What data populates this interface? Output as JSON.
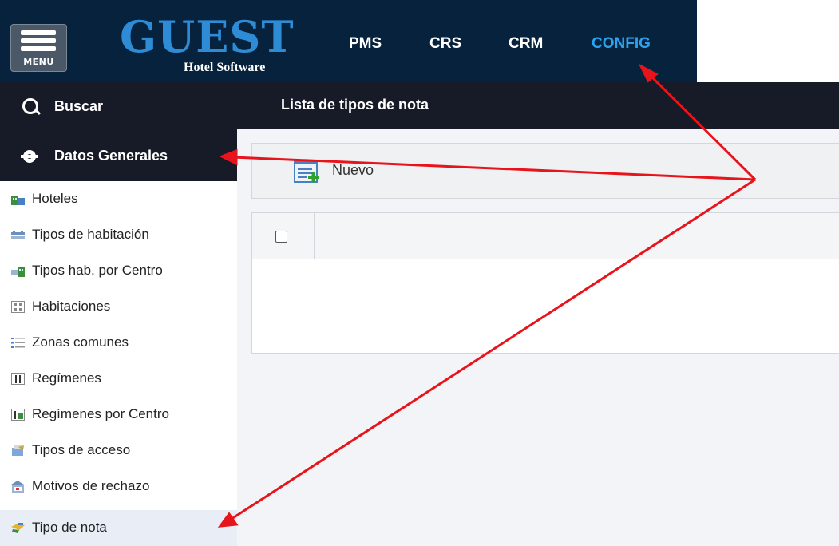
{
  "header": {
    "menu_label": "MENU",
    "logo_title": "GUEST",
    "logo_subtitle": "Hotel Software",
    "nav": [
      "PMS",
      "CRS",
      "CRM",
      "CONFIG"
    ],
    "active_nav": "CONFIG"
  },
  "page_title": "Lista de tipos de nota",
  "sidebar": {
    "search_label": "Buscar",
    "section_label": "Datos Generales",
    "items": [
      {
        "label": "Hoteles",
        "icon": "hotel-icon"
      },
      {
        "label": "Tipos de habitación",
        "icon": "room-type-icon"
      },
      {
        "label": "Tipos hab. por Centro",
        "icon": "room-type-center-icon"
      },
      {
        "label": "Habitaciones",
        "icon": "rooms-icon"
      },
      {
        "label": "Zonas comunes",
        "icon": "list-icon"
      },
      {
        "label": "Regímenes",
        "icon": "cutlery-icon"
      },
      {
        "label": "Regímenes por Centro",
        "icon": "cutlery-center-icon"
      },
      {
        "label": "Tipos de acceso",
        "icon": "access-icon"
      },
      {
        "label": "Motivos de rechazo",
        "icon": "reject-icon"
      },
      {
        "label": "Tipo de nota",
        "icon": "note-type-icon",
        "selected": true
      }
    ]
  },
  "toolbar": {
    "new_label": "Nuevo"
  },
  "colors": {
    "header_bg": "#06223d",
    "accent": "#2aa4f1",
    "annotation": "#e8141c"
  }
}
